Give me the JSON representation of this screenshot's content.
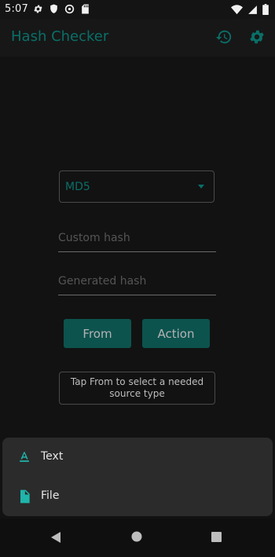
{
  "status_bar": {
    "time": "5:07",
    "left_icons": [
      "settings-icon",
      "shield-icon",
      "data-saver-icon",
      "sd-card-icon"
    ],
    "right_icons": [
      "wifi-icon",
      "cell-signal-icon",
      "battery-icon"
    ]
  },
  "app_bar": {
    "title": "Hash Checker",
    "actions": [
      "history-icon",
      "settings-icon"
    ],
    "accent_color": "#0a6f68"
  },
  "form": {
    "hash_type": "MD5",
    "custom_hash_placeholder": "Custom hash",
    "generated_hash_placeholder": "Generated hash",
    "from_button": "From",
    "action_button": "Action",
    "hint": "Tap From to select a needed source type"
  },
  "bottom_sheet": {
    "items": [
      {
        "label": "Text",
        "icon": "text-format-icon"
      },
      {
        "label": "File",
        "icon": "file-icon"
      }
    ]
  },
  "nav_bar": {
    "buttons": [
      "back-icon",
      "home-icon",
      "recents-icon"
    ]
  }
}
